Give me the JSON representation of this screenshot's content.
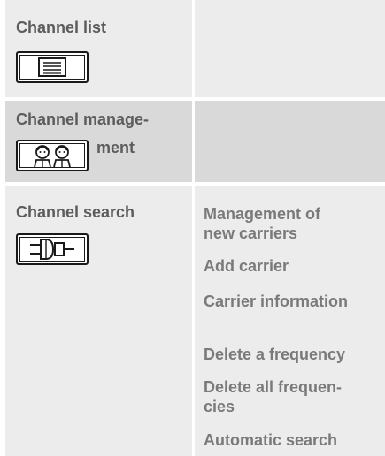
{
  "menu": {
    "channel_list": {
      "label": "Channel list",
      "icon": "list-icon"
    },
    "channel_management": {
      "label_line1": "Channel manage-",
      "label_line2": "ment",
      "icon": "people-icon"
    },
    "channel_search": {
      "label": "Channel search",
      "icon": "plug-icon",
      "options": [
        {
          "line1": "Management of",
          "line2": "new carriers"
        },
        {
          "line1": "Add carrier"
        },
        {
          "line1": "Carrier information"
        },
        {
          "line1": "Delete a frequency"
        },
        {
          "line1": "Delete all frequen-",
          "line2": "cies"
        },
        {
          "line1": "Automatic search"
        }
      ]
    }
  },
  "colors": {
    "light_cell": "#ececec",
    "highlight_cell": "#d9d9d9",
    "title_text": "#5c5c5c",
    "option_text": "#7a7a7a",
    "icon_border": "#1a1a1a"
  }
}
